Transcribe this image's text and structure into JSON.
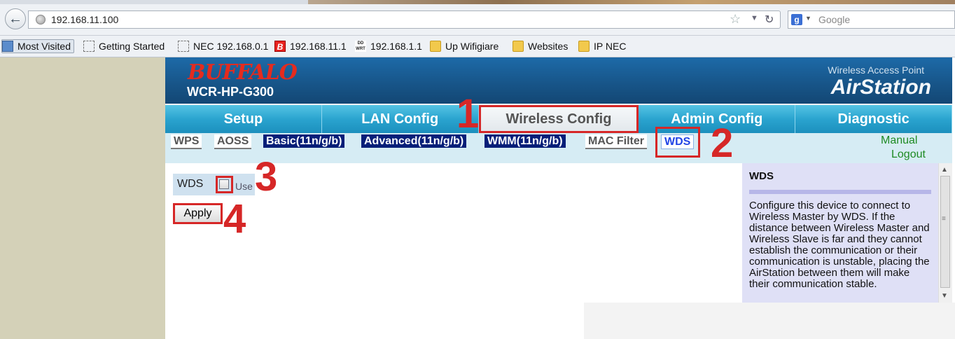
{
  "browser": {
    "url": "192.168.11.100",
    "search_placeholder": "Google",
    "bookmarks": [
      {
        "label": "Most Visited",
        "icon": "most-visited-icon"
      },
      {
        "label": "Getting Started",
        "icon": "page-icon"
      },
      {
        "label": "NEC 192.168.0.1",
        "icon": "page-icon"
      },
      {
        "label": "192.168.11.1",
        "icon": "buffalo-b-icon"
      },
      {
        "label": "192.168.1.1",
        "icon": "ddwrt-icon"
      },
      {
        "label": "Up Wifigiare",
        "icon": "folder-icon"
      },
      {
        "label": "Websites",
        "icon": "folder-icon"
      },
      {
        "label": "IP NEC",
        "icon": "folder-icon"
      }
    ]
  },
  "router": {
    "brand": "BUFFALO",
    "model": "WCR-HP-G300",
    "product_sub": "Wireless Access Point",
    "product_name": "AirStation",
    "tabs": [
      "Setup",
      "LAN Config",
      "Wireless Config",
      "Admin Config",
      "Diagnostic"
    ],
    "active_tab": "Wireless Config",
    "subtabs": [
      "WPS",
      "AOSS",
      "Basic(11n/g/b)",
      "Advanced(11n/g/b)",
      "WMM(11n/g/b)",
      "MAC Filter",
      "WDS"
    ],
    "active_subtab": "WDS",
    "manual": "Manual",
    "logout": "Logout"
  },
  "form": {
    "wds_label": "WDS",
    "use_label": "Use",
    "use_checked": false,
    "apply": "Apply"
  },
  "help": {
    "title": "WDS",
    "body": "Configure this device to connect to Wireless Master by WDS. If the distance between Wireless Master and Wireless Slave is far and they cannot establish the communication or their communication is unstable, placing the AirStation between them will make their communication stable."
  },
  "annotations": [
    "1",
    "2",
    "3",
    "4"
  ],
  "colors": {
    "accent_red": "#d62727",
    "header_blue": "#175487",
    "tab_cyan": "#2aa4cf",
    "subtab_navy": "#051e78",
    "link_green": "#1f8b24"
  }
}
